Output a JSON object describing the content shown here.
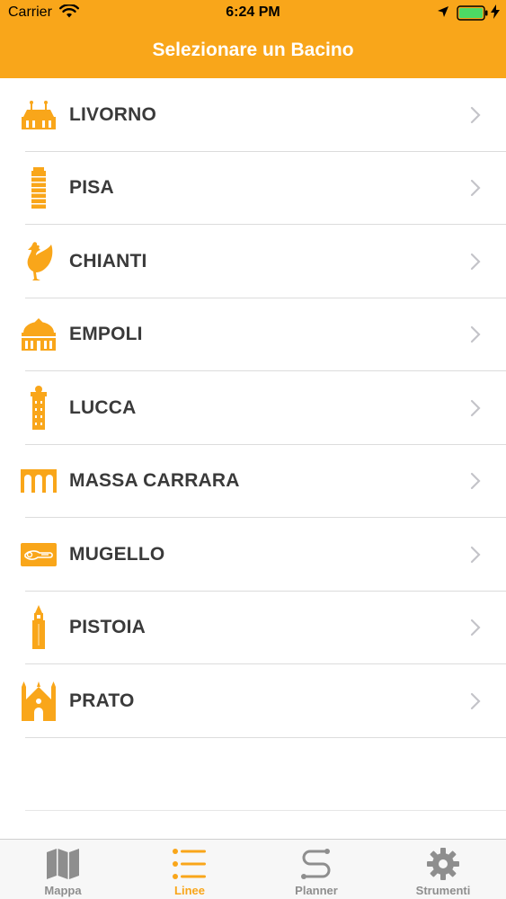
{
  "status_bar": {
    "carrier": "Carrier",
    "time": "6:24 PM"
  },
  "nav": {
    "title": "Selezionare un Bacino"
  },
  "colors": {
    "accent": "#F9A61A",
    "label": "#3a3a3a",
    "chevron": "#c4c4c9",
    "tab_inactive": "#8e8e8e"
  },
  "basins": [
    {
      "label": "LIVORNO",
      "icon": "livorno-terrazza-icon"
    },
    {
      "label": "PISA",
      "icon": "leaning-tower-icon"
    },
    {
      "label": "CHIANTI",
      "icon": "rooster-icon"
    },
    {
      "label": "EMPOLI",
      "icon": "church-facade-icon"
    },
    {
      "label": "LUCCA",
      "icon": "guinigi-tower-icon"
    },
    {
      "label": "MASSA CARRARA",
      "icon": "arches-icon"
    },
    {
      "label": "MUGELLO",
      "icon": "motorbike-badge-icon"
    },
    {
      "label": "PISTOIA",
      "icon": "bell-tower-icon"
    },
    {
      "label": "PRATO",
      "icon": "cathedral-icon"
    }
  ],
  "tabs": [
    {
      "label": "Mappa",
      "icon": "map-icon",
      "active": false
    },
    {
      "label": "Linee",
      "icon": "list-icon",
      "active": true
    },
    {
      "label": "Planner",
      "icon": "route-icon",
      "active": false
    },
    {
      "label": "Strumenti",
      "icon": "gear-icon",
      "active": false
    }
  ]
}
